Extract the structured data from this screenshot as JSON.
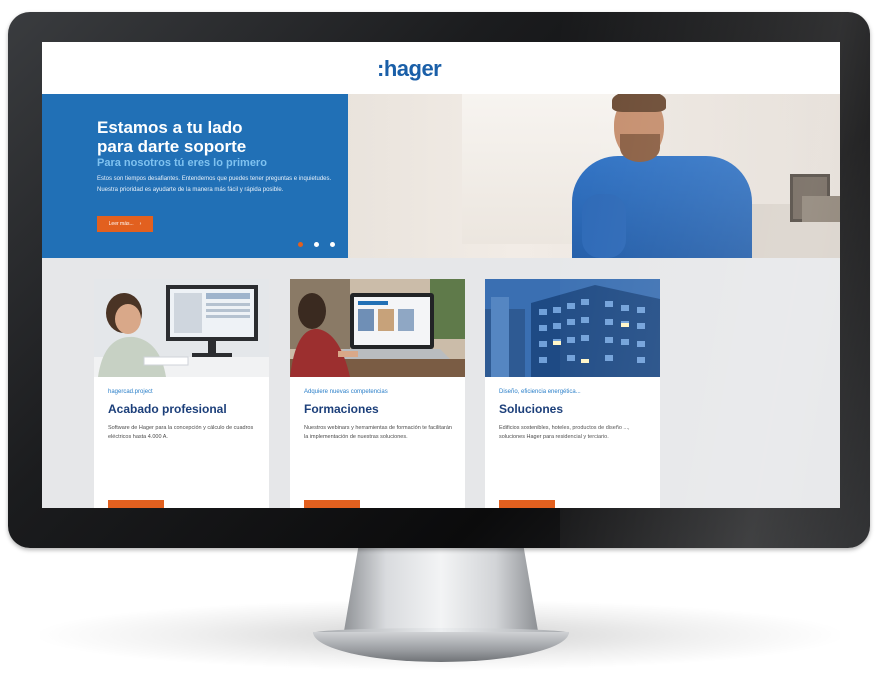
{
  "site": {
    "logo": ":hager"
  },
  "hero": {
    "title": "Estamos a tu lado\npara darte soporte",
    "subtitle": "Para nosotros tú eres lo primero",
    "text": "Estos son tiempos desafiantes. Entendemos que puedes tener preguntas e inquietudes. Nuestra prioridad es ayudarte de la manera más fácil y rápida posible.",
    "button_label": "Leer más...",
    "button_icon": "chevron-right-icon",
    "slides_count": 3,
    "active_slide": 1
  },
  "cards": [
    {
      "eyebrow": "hagercad.project",
      "title": "Acabado profesional",
      "text": "Software de Hager para la concepción y cálculo de cuadros eléctricos hasta 4.000 A."
    },
    {
      "eyebrow": "Adquiere nuevas competencias",
      "title": "Formaciones",
      "text": "Nuestros webinars y herramientas de formación te facilitarán la implementación de nuestras soluciones."
    },
    {
      "eyebrow": "Diseño, eficiencia energética...",
      "title": "Soluciones",
      "text": "Edificios sostenibles, hoteles, productos de diseño ..., soluciones Hager para residencial y terciario."
    }
  ],
  "colors": {
    "brand_blue": "#2170b6",
    "accent_orange": "#e2601f",
    "title_navy": "#1c3f7a",
    "link_blue": "#2a7fc9"
  }
}
